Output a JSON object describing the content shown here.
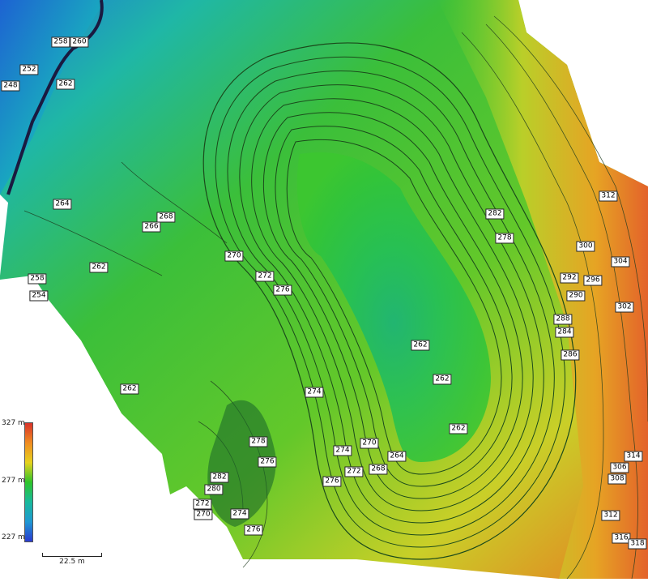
{
  "map": {
    "legend": {
      "unit": "m",
      "max": "327 m",
      "mid": "277 m",
      "min": "227 m"
    },
    "scale_bar": {
      "label": "22.5 m"
    },
    "contour_labels": [
      {
        "v": "258"
      },
      {
        "v": "260"
      },
      {
        "v": "252"
      },
      {
        "v": "248"
      },
      {
        "v": "262"
      },
      {
        "v": "264"
      },
      {
        "v": "268"
      },
      {
        "v": "266"
      },
      {
        "v": "262"
      },
      {
        "v": "270"
      },
      {
        "v": "272"
      },
      {
        "v": "276"
      },
      {
        "v": "258"
      },
      {
        "v": "254"
      },
      {
        "v": "262"
      },
      {
        "v": "274"
      },
      {
        "v": "262"
      },
      {
        "v": "262"
      },
      {
        "v": "262"
      },
      {
        "v": "278"
      },
      {
        "v": "276"
      },
      {
        "v": "282"
      },
      {
        "v": "280"
      },
      {
        "v": "272"
      },
      {
        "v": "270"
      },
      {
        "v": "274"
      },
      {
        "v": "276"
      },
      {
        "v": "274"
      },
      {
        "v": "270"
      },
      {
        "v": "264"
      },
      {
        "v": "268"
      },
      {
        "v": "272"
      },
      {
        "v": "276"
      },
      {
        "v": "282"
      },
      {
        "v": "278"
      },
      {
        "v": "312"
      },
      {
        "v": "300"
      },
      {
        "v": "304"
      },
      {
        "v": "292"
      },
      {
        "v": "296"
      },
      {
        "v": "290"
      },
      {
        "v": "302"
      },
      {
        "v": "288"
      },
      {
        "v": "284"
      },
      {
        "v": "286"
      },
      {
        "v": "314"
      },
      {
        "v": "306"
      },
      {
        "v": "308"
      },
      {
        "v": "312"
      },
      {
        "v": "316"
      },
      {
        "v": "318"
      }
    ],
    "colors": {
      "low": "#2a3bd0",
      "mid_low": "#18b99c",
      "mid": "#2fc42b",
      "mid_high": "#e6d21e",
      "high": "#d8322a"
    }
  }
}
